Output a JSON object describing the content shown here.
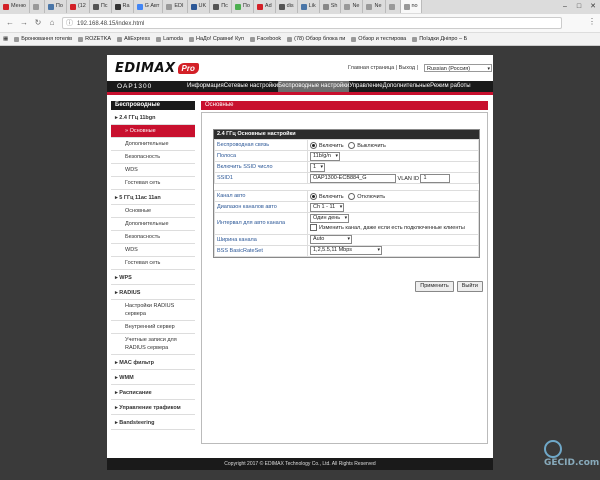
{
  "browser": {
    "tabs": [
      {
        "label": "Меню",
        "color": "#d32027"
      },
      {
        "label": "",
        "color": "#999999"
      },
      {
        "label": "По",
        "color": "#4a76a8"
      },
      {
        "label": "(12",
        "color": "#d32027"
      },
      {
        "label": "Пс",
        "color": "#555555"
      },
      {
        "label": "Ra",
        "color": "#333333"
      },
      {
        "label": "G Авт",
        "color": "#4285f4"
      },
      {
        "label": "EDI",
        "color": "#999999"
      },
      {
        "label": "UK",
        "color": "#2b5797"
      },
      {
        "label": "Пс",
        "color": "#555555"
      },
      {
        "label": "По",
        "color": "#4caf50"
      },
      {
        "label": "Ad",
        "color": "#d32027"
      },
      {
        "label": "dis",
        "color": "#555555"
      },
      {
        "label": "Lik",
        "color": "#4a76a8"
      },
      {
        "label": "Sh",
        "color": "#888888"
      },
      {
        "label": "Ne",
        "color": "#999999"
      },
      {
        "label": "Ne",
        "color": "#999999"
      },
      {
        "label": "",
        "color": "#999999"
      },
      {
        "label": "no",
        "color": "#999999"
      }
    ],
    "url": "192.168.48.15/index.html",
    "bookmarks": [
      "Бронювання готелів",
      "ROZETKA",
      "AliExpress",
      "Lamoda",
      "НаДо! Сравни! Куп",
      "Facebook",
      "(78) Обзор блока пи",
      "Обзор и тестирова",
      "Поїздки Дніпро – Б"
    ]
  },
  "header": {
    "logo_text": "EDIMAX",
    "logo_badge": "Pro",
    "links": "Главная страница | Выход | ",
    "language": "Russian (Россия)",
    "model": "OAP1300",
    "nav": [
      {
        "label": "Информация",
        "active": false
      },
      {
        "label": "Сетевые настройки",
        "active": false
      },
      {
        "label": "Беспроводные настройки",
        "active": true
      },
      {
        "label": "Управление",
        "active": false
      },
      {
        "label": "Дополнительные",
        "active": false
      },
      {
        "label": "Режим работы",
        "active": false
      }
    ]
  },
  "sidebar": {
    "title": "Беспроводные",
    "items": [
      {
        "label": "2.4 ГГц 11bgn",
        "level": 0,
        "active": false
      },
      {
        "label": "Основные",
        "level": 1,
        "active": true
      },
      {
        "label": "Дополнительные",
        "level": 1,
        "active": false
      },
      {
        "label": "Безопасность",
        "level": 1,
        "active": false
      },
      {
        "label": "WDS",
        "level": 1,
        "active": false
      },
      {
        "label": "Гостевая сеть",
        "level": 1,
        "active": false
      },
      {
        "label": "5 ГГц 11ac 11an",
        "level": 0,
        "active": false
      },
      {
        "label": "Основные",
        "level": 1,
        "active": false
      },
      {
        "label": "Дополнительные",
        "level": 1,
        "active": false
      },
      {
        "label": "Безопасность",
        "level": 1,
        "active": false
      },
      {
        "label": "WDS",
        "level": 1,
        "active": false
      },
      {
        "label": "Гостевая сеть",
        "level": 1,
        "active": false
      },
      {
        "label": "WPS",
        "level": 0,
        "active": false
      },
      {
        "label": "RADIUS",
        "level": 0,
        "active": false
      },
      {
        "label": "Настройки RADIUS сервера",
        "level": 1,
        "active": false
      },
      {
        "label": "Внутренний сервер",
        "level": 1,
        "active": false
      },
      {
        "label": "Учетные записи для RADIUS сервера",
        "level": 1,
        "active": false
      },
      {
        "label": "MAC фильтр",
        "level": 0,
        "active": false
      },
      {
        "label": "WMM",
        "level": 0,
        "active": false
      },
      {
        "label": "Расписание",
        "level": 0,
        "active": false
      },
      {
        "label": "Управление трафиком",
        "level": 0,
        "active": false
      },
      {
        "label": "Bandsteering",
        "level": 0,
        "active": false
      }
    ]
  },
  "content": {
    "title": "Основные",
    "box_title": "2.4 ГГц Основные настройки",
    "rows": {
      "wireless": {
        "label": "Беспроводная связь",
        "on": "Включить",
        "off": "Выключить"
      },
      "band": {
        "label": "Полоса",
        "value": "11b/g/n"
      },
      "ssid_count": {
        "label": "Включить SSID число",
        "value": "1"
      },
      "ssid1": {
        "label": "SSID1",
        "value": "OAP1300-ECB884_G",
        "vlan_label": "VLAN ID",
        "vlan_value": "1"
      },
      "auto_channel": {
        "label": "Канал авто",
        "on": "Включить",
        "off": "Отключить"
      },
      "channel_range": {
        "label": "Диапазон каналов авто",
        "value": "Ch 1 - 11"
      },
      "auto_interval": {
        "label": "Интервал для авто канала",
        "value": "Один день",
        "checkbox_label": "Изменить канал, даже если есть подключенные клиенты"
      },
      "channel_width": {
        "label": "Ширина канала",
        "value": "Auto"
      },
      "bss_rate": {
        "label": "BSS BasicRateSet",
        "value": "1,2,5.5,11 Mbps"
      }
    },
    "apply_button": "Применить",
    "cancel_button": "Выйти"
  },
  "footer": "Copyright 2017 © EDIMAX Technology Co., Ltd. All Rights Reserved",
  "watermark": "GECID.com"
}
